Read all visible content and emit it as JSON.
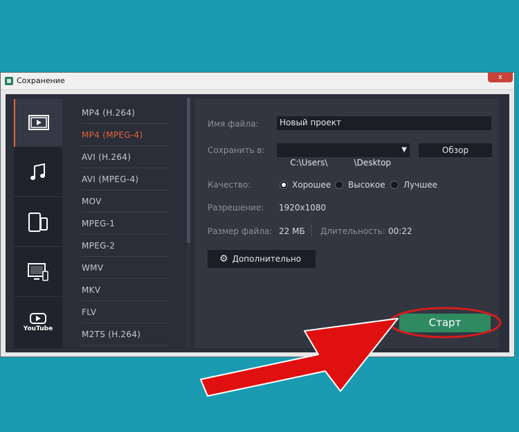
{
  "window": {
    "title": "Сохранение",
    "close_symbol": "x"
  },
  "categories": [
    {
      "name": "video",
      "icon": "film-icon",
      "active": true
    },
    {
      "name": "audio",
      "icon": "music-note-icon",
      "active": false
    },
    {
      "name": "devices",
      "icon": "mobile-devices-icon",
      "active": false
    },
    {
      "name": "tv",
      "icon": "tv-icon",
      "active": false
    },
    {
      "name": "youtube",
      "icon": "youtube-icon",
      "active": false,
      "label": "YouTube"
    }
  ],
  "formats": [
    {
      "label": "MP4 (H.264)",
      "active": false
    },
    {
      "label": "MP4 (MPEG-4)",
      "active": true
    },
    {
      "label": "AVI (H.264)",
      "active": false
    },
    {
      "label": "AVI (MPEG-4)",
      "active": false
    },
    {
      "label": "MOV",
      "active": false
    },
    {
      "label": "MPEG-1",
      "active": false
    },
    {
      "label": "MPEG-2",
      "active": false
    },
    {
      "label": "WMV",
      "active": false
    },
    {
      "label": "MKV",
      "active": false
    },
    {
      "label": "FLV",
      "active": false
    },
    {
      "label": "M2TS (H.264)",
      "active": false
    }
  ],
  "settings": {
    "filename_label": "Имя файла:",
    "filename_value": "Новый проект",
    "save_to_label": "Сохранить в:",
    "save_to_value": "C:\\Users\\          \\Desktop",
    "browse_label": "Обзор",
    "quality_label": "Качество:",
    "quality_options": [
      {
        "label": "Хорошее",
        "selected": true
      },
      {
        "label": "Высокое",
        "selected": false
      },
      {
        "label": "Лучшее",
        "selected": false
      }
    ],
    "resolution_label": "Разрешение:",
    "resolution_value": "1920x1080",
    "filesize_label": "Размер файла:",
    "filesize_value": "22 МБ",
    "duration_label": "Длительность:",
    "duration_value": "00:22",
    "advanced_label": "Дополнительно",
    "start_label": "Старт"
  },
  "colors": {
    "accent": "#e8623a",
    "start": "#2f8a62",
    "highlight": "#e01010"
  }
}
